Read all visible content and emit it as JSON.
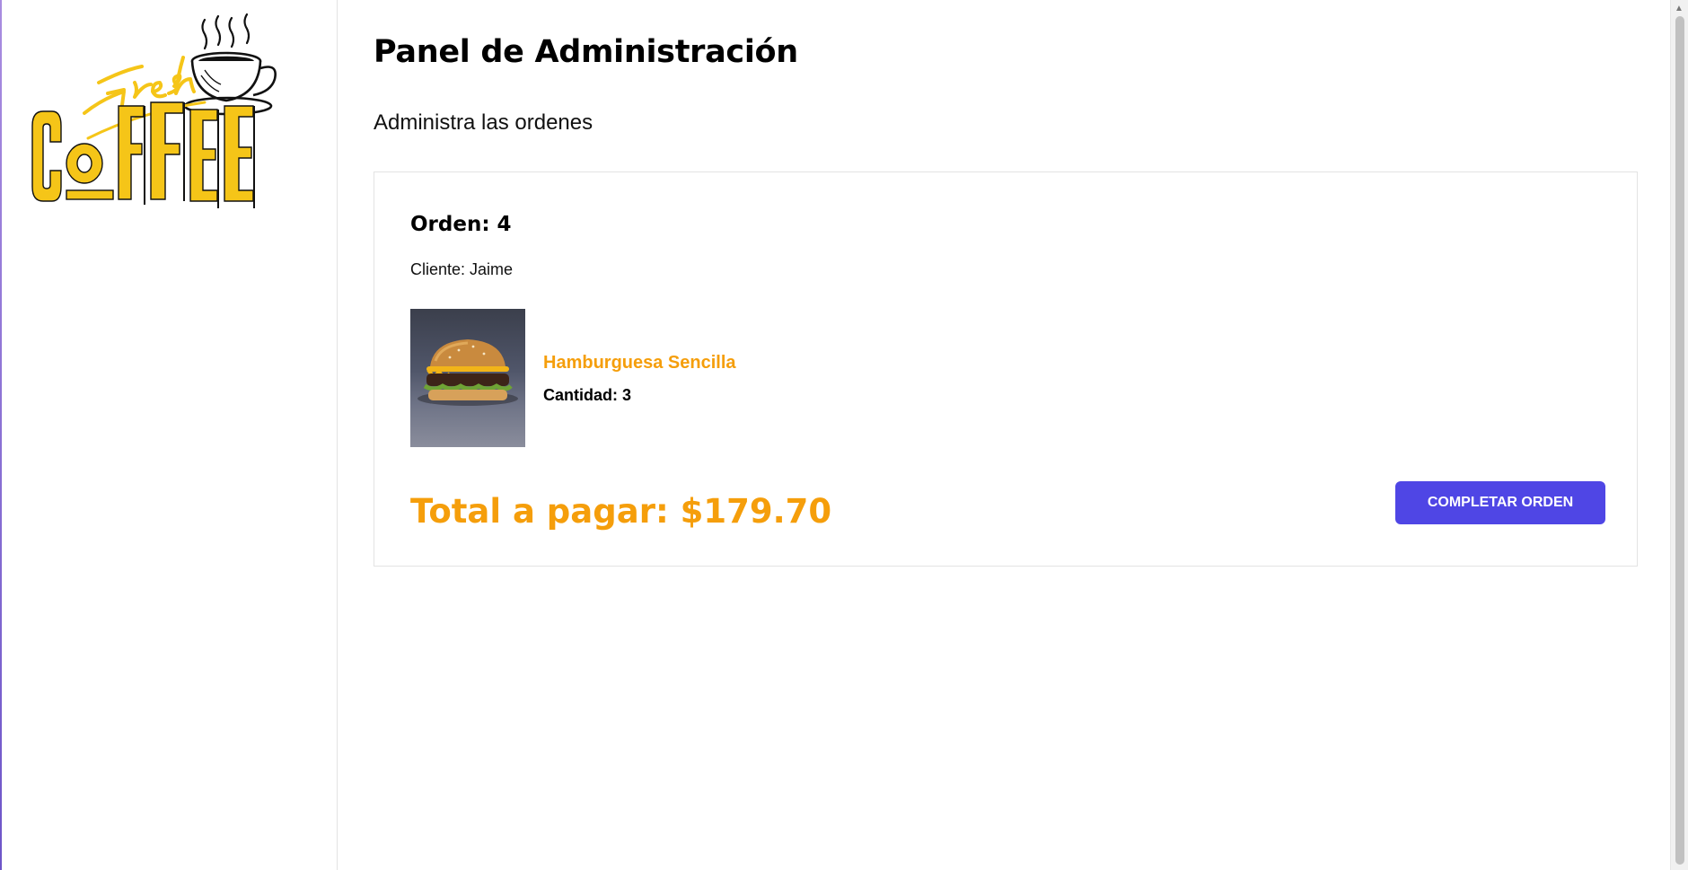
{
  "sidebar": {
    "logo_alt": "Fresh Coffee"
  },
  "main": {
    "title": "Panel de Administración",
    "subtitle": "Administra las ordenes"
  },
  "order": {
    "number_label": "Orden: 4",
    "client_label": "Cliente: Jaime",
    "items": [
      {
        "name": "Hamburguesa Sencilla",
        "quantity_label": "Cantidad: 3",
        "image": "burger-photo"
      }
    ],
    "total_label": "Total a pagar: $179.70",
    "complete_button_label": "COMPLETAR ORDEN"
  },
  "colors": {
    "accent": "#f59e0b",
    "primary_button": "#4f46e5",
    "logo_yellow": "#f5c518"
  },
  "icons": {
    "scroll_up": "chevron-up-icon",
    "logo_cup": "coffee-cup-icon"
  }
}
